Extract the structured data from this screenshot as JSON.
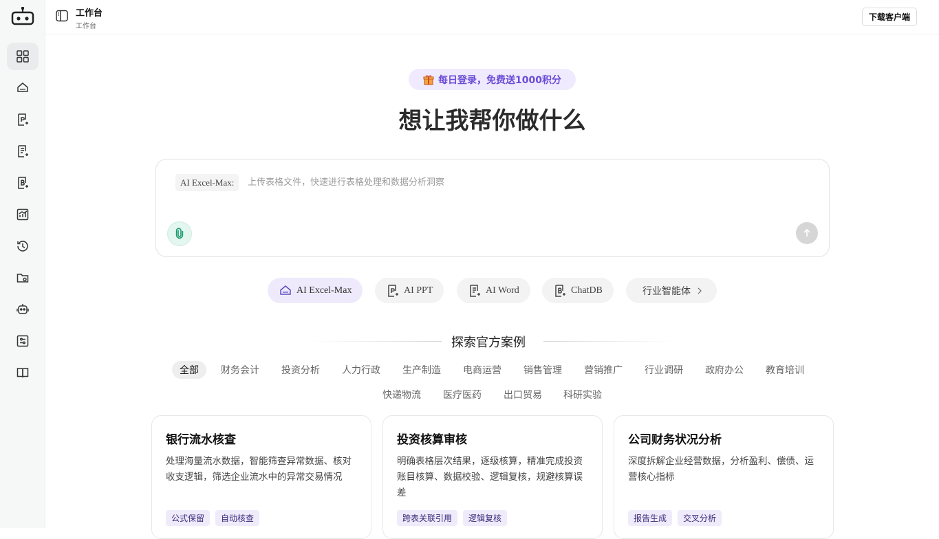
{
  "header": {
    "title": "工作台",
    "subtitle": "工作台",
    "download_label": "下载客户端"
  },
  "sidebar": {
    "items": [
      {
        "icon": "grid-icon"
      },
      {
        "icon": "excel-ai-icon"
      },
      {
        "icon": "ppt-ai-icon"
      },
      {
        "icon": "word-ai-icon"
      },
      {
        "icon": "chatdb-icon"
      },
      {
        "icon": "chart-report-icon"
      },
      {
        "icon": "history-icon"
      },
      {
        "icon": "folder-icon"
      },
      {
        "icon": "robot-icon"
      },
      {
        "icon": "settings-sliders-icon"
      },
      {
        "icon": "book-icon"
      }
    ]
  },
  "hero": {
    "promo": "每日登录，免费送1000积分",
    "title": "想让我帮你做什么"
  },
  "composer": {
    "mode_tag": "AI Excel-Max:",
    "placeholder": "上传表格文件，快速进行表格处理和数据分析洞察"
  },
  "tools": [
    {
      "label": "AI Excel-Max",
      "active": true
    },
    {
      "label": "AI PPT"
    },
    {
      "label": "AI Word"
    },
    {
      "label": "ChatDB"
    },
    {
      "label": "行业智能体"
    }
  ],
  "explore": {
    "title": "探索官方案例",
    "categories_row1": [
      "全部",
      "财务会计",
      "投资分析",
      "人力行政",
      "生产制造",
      "电商运营",
      "销售管理",
      "营销推广",
      "行业调研",
      "政府办公",
      "教育培训"
    ],
    "categories_row2": [
      "快递物流",
      "医疗医药",
      "出口贸易",
      "科研实验"
    ]
  },
  "cards": [
    {
      "title": "银行流水核查",
      "desc": "处理海量流水数据，智能筛查异常数据、核对收支逻辑，筛选企业流水中的异常交易情况",
      "tags": [
        "公式保留",
        "自动核查"
      ]
    },
    {
      "title": "投资核算审核",
      "desc": "明确表格层次结果，逐级核算，精准完成投资账目核算、数据校验、逻辑复核，规避核算误差",
      "tags": [
        "跨表关联引用",
        "逻辑复核"
      ]
    },
    {
      "title": "公司财务状况分析",
      "desc": "深度拆解企业经营数据，分析盈利、偿债、运营核心指标",
      "tags": [
        "报告生成",
        "交叉分析"
      ]
    }
  ],
  "colors": {
    "accent": "#6b4cd6",
    "promo_bg": "#efeafd",
    "attach_green": "#1a9a6c"
  }
}
